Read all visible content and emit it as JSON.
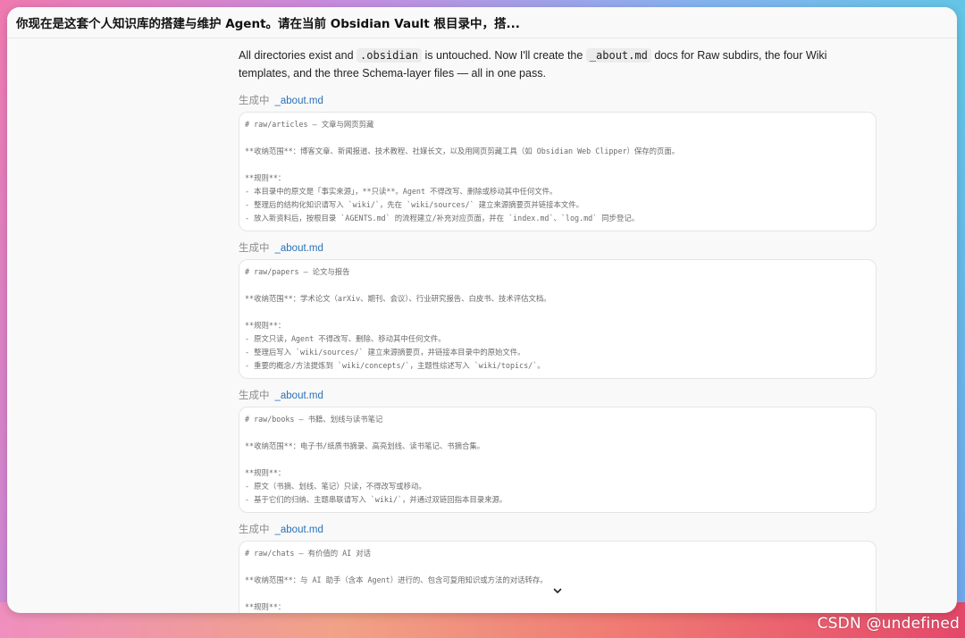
{
  "window": {
    "title": "你现在是这套个人知识库的搭建与维护 Agent。请在当前 Obsidian Vault 根目录中，搭..."
  },
  "message": {
    "p1": "All directories exist and",
    "code1": ".obsidian",
    "p2": "is untouched. Now I'll create the",
    "code2": "_about.md",
    "p3": "docs for Raw subdirs, the four Wiki templates, and the three Schema-layer files — all in one pass."
  },
  "blocks": [
    {
      "status": "生成中",
      "file": "_about.md",
      "lines": [
        "# raw/articles — 文章与网页剪藏",
        "",
        "**收纳范围**：博客文章、新闻报道、技术教程、社媒长文，以及用网页剪藏工具（如 Obsidian Web Clipper）保存的页面。",
        "",
        "**规则**：",
        "- 本目录中的原文是「事实来源」，**只读**。Agent 不得改写、删除或移动其中任何文件。",
        "- 整理后的结构化知识请写入 `wiki/`，先在 `wiki/sources/` 建立来源摘要页并链接本文件。",
        "- 放入新资料后，按根目录 `AGENTS.md` 的流程建立/补充对应页面，并在 `index.md`、`log.md` 同步登记。"
      ]
    },
    {
      "status": "生成中",
      "file": "_about.md",
      "lines": [
        "# raw/papers — 论文与报告",
        "",
        "**收纳范围**：学术论文（arXiv、期刊、会议）、行业研究报告、白皮书、技术评估文档。",
        "",
        "**规则**：",
        "- 原文只读，Agent 不得改写、删除、移动其中任何文件。",
        "- 整理后写入 `wiki/sources/` 建立来源摘要页，并链接本目录中的原始文件。",
        "- 重要的概念/方法提炼到 `wiki/concepts/`，主题性综述写入 `wiki/topics/`。"
      ]
    },
    {
      "status": "生成中",
      "file": "_about.md",
      "lines": [
        "# raw/books — 书籍、划线与读书笔记",
        "",
        "**收纳范围**：电子书/纸质书摘录、高亮划线、读书笔记、书摘合集。",
        "",
        "**规则**：",
        "- 原文（书摘、划线、笔记）只读，不得改写或移动。",
        "- 基于它们的归纳、主题串联请写入 `wiki/`，并通过双链回指本目录来源。"
      ]
    },
    {
      "status": "生成中",
      "file": "_about.md",
      "lines": [
        "# raw/chats — 有价值的 AI 对话",
        "",
        "**收纳范围**：与 AI 助手（含本 Agent）进行的、包含可复用知识或方法的对话转存。",
        "",
        "**规则**："
      ]
    }
  ],
  "icons": {
    "scroll_down": "chevron-down-icon"
  },
  "watermark": "CSDN @undefined"
}
